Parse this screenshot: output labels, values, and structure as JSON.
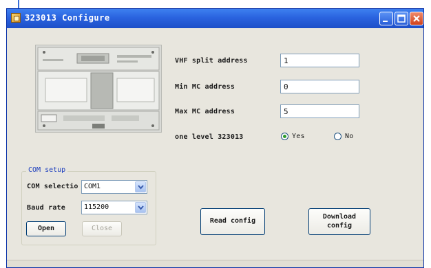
{
  "window": {
    "title": "323013 Configure",
    "controls": [
      "minimize-icon",
      "maximize-icon",
      "close-icon"
    ]
  },
  "config": {
    "vhf_split_address": {
      "label": "VHF split address",
      "value": "1"
    },
    "min_mc_address": {
      "label": "Min MC address",
      "value": "0"
    },
    "max_mc_address": {
      "label": "Max MC address",
      "value": "5"
    },
    "one_level": {
      "label": "one level 323013",
      "options": [
        {
          "label": "Yes",
          "selected": true
        },
        {
          "label": "No",
          "selected": false
        }
      ]
    }
  },
  "com_setup": {
    "title": "COM setup",
    "com_selection": {
      "label": "COM selectio",
      "value": "COM1"
    },
    "baud_rate": {
      "label": "Baud rate",
      "value": "115200"
    },
    "open_label": "Open",
    "close_label": "Close",
    "close_enabled": false
  },
  "actions": {
    "read_config": "Read config",
    "download_config_line1": "Download",
    "download_config_line2": "config"
  },
  "colors": {
    "titlebar": "#2a63df",
    "window_bg": "#e8e6de",
    "group_title": "#1a3cbd",
    "radio_dot": "#2a9a2a"
  }
}
